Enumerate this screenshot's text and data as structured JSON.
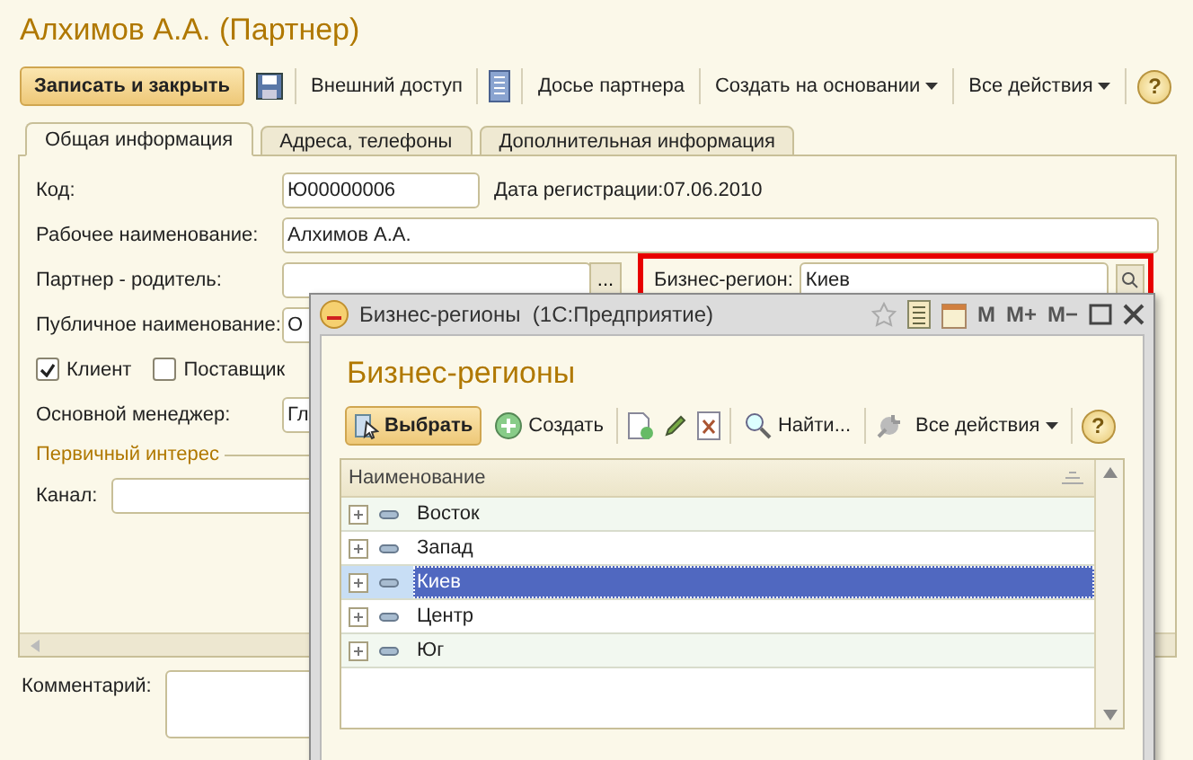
{
  "title": "Алхимов А.А. (Партнер)",
  "toolbar": {
    "save": "Записать и закрыть",
    "actions": [
      {
        "label": "Внешний доступ",
        "dropdown": false
      },
      {
        "label": "Досье партнера",
        "dropdown": false
      },
      {
        "label": "Создать на основании",
        "dropdown": true
      },
      {
        "label": "Все действия",
        "dropdown": true
      }
    ],
    "help": "?"
  },
  "tabs": [
    {
      "label": "Общая информация",
      "selected": true
    },
    {
      "label": "Адреса, телефоны",
      "selected": false
    },
    {
      "label": "Дополнительная информация",
      "selected": false
    }
  ],
  "form": {
    "code_label": "Код:",
    "code_value": "Ю00000006",
    "reg_date": "Дата регистрации:07.06.2010",
    "work_name_label": "Рабочее наименование:",
    "work_name_value": "Алхимов А.А.",
    "parent_label": "Партнер - родитель:",
    "pick_button": "...",
    "region": {
      "label": "Бизнес-регион:",
      "value": "Киев",
      "highlighted": true
    },
    "public_name_label": "Публичное наименование:",
    "public_name_value": "О",
    "checkboxes": [
      {
        "label": "Клиент",
        "checked": true
      },
      {
        "label": "Поставщик",
        "checked": false
      }
    ],
    "manager_label": "Основной менеджер:",
    "manager_value": "Гл",
    "section": "Первичный интерес",
    "channel_label": "Канал:",
    "comment_label": "Комментарий:"
  },
  "popup": {
    "window_title": "Бизнес-регионы  (1С:Предприятие)",
    "memory_buttons": [
      "M",
      "M+",
      "M−"
    ],
    "heading": "Бизнес-регионы",
    "select": "Выбрать",
    "create": "Создать",
    "find": "Найти...",
    "all_actions": "Все действия",
    "help": "?",
    "column": "Наименование",
    "rows": [
      {
        "name": "Восток",
        "selected": false
      },
      {
        "name": "Запад",
        "selected": false
      },
      {
        "name": "Киев",
        "selected": true
      },
      {
        "name": "Центр",
        "selected": false
      },
      {
        "name": "Юг",
        "selected": false
      }
    ]
  }
}
